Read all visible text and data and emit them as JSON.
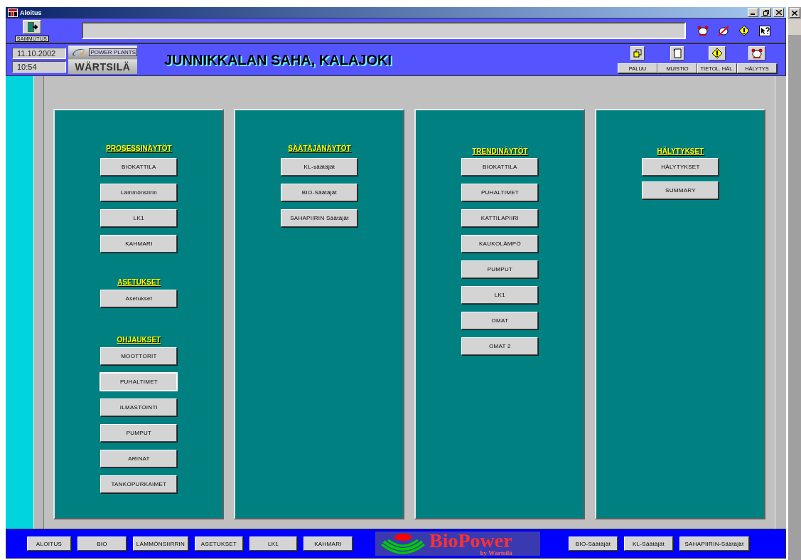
{
  "window": {
    "title": "Aloitus"
  },
  "toolbar": {
    "shutdown_label": "SAMMUTUS"
  },
  "header": {
    "date": "11.10.2002",
    "time": "10:54",
    "logo": {
      "tagline": "POWER PLANTS",
      "brand": "WÄRTSILÄ"
    },
    "title": "JUNNIKKALAN SAHA, KALAJOKI",
    "nav_buttons": [
      "PALUU",
      "MUISTIO",
      "TIETOL. HÄL.",
      "HÄLYTYS"
    ]
  },
  "panels": [
    {
      "sections": [
        {
          "heading": "PROSESSINÄYTÖT",
          "buttons": [
            {
              "label": "BIOKATTILA"
            },
            {
              "label": "Lämmönsiirin"
            },
            {
              "label": "LK1"
            },
            {
              "label": "KAHMARI"
            }
          ]
        },
        {
          "heading": "ASETUKSET",
          "buttons": [
            {
              "label": "Asetukset"
            }
          ]
        },
        {
          "heading": "OHJAUKSET",
          "buttons": [
            {
              "label": "MOOTTORIT",
              "focused": false
            },
            {
              "label": "PUHALTIMET",
              "focused": true
            },
            {
              "label": "ILMASTOINTI",
              "focused": false
            },
            {
              "label": "PUMPUT",
              "focused": false
            },
            {
              "label": "ARINAT",
              "focused": false
            },
            {
              "label": "TANKOPURKAIMET",
              "focused": false
            }
          ]
        }
      ]
    },
    {
      "sections": [
        {
          "heading": "SÄÄTÄJÄNÄYTÖT",
          "buttons": [
            {
              "label": "KL-säätäjät"
            },
            {
              "label": "BIO-Säätäjät"
            },
            {
              "label": "SAHAPIIRIN Säätäjät"
            }
          ]
        }
      ]
    },
    {
      "sections": [
        {
          "heading": "TRENDINÄYTÖT",
          "buttons": [
            {
              "label": "BIOKATTILA"
            },
            {
              "label": "PUHALTIMET"
            },
            {
              "label": "KATTILAPIIRI"
            },
            {
              "label": "KAUKOLÄMPÖ"
            },
            {
              "label": "PUMPUT"
            },
            {
              "label": "LK1"
            },
            {
              "label": "OMAT"
            },
            {
              "label": "OMAT 2"
            }
          ]
        }
      ]
    },
    {
      "sections": [
        {
          "heading": "HÄLYTYKSET",
          "buttons": [
            {
              "label": "HÄLYTYKSET"
            },
            {
              "label": "SUMMARY"
            }
          ]
        }
      ]
    }
  ],
  "bottom_bar": {
    "left_buttons": [
      "ALOITUS",
      "BIO",
      "LÄMMÖNSIIRRIN",
      "ASETUKSET",
      "LK1",
      "KAHMARI"
    ],
    "logo": {
      "name": "BioPower",
      "byline": "by Wärtsilä"
    },
    "right_buttons": [
      "BIO-Säätäjät",
      "KL-Säätäjät",
      "SAHAPIIRIN-Säätäjät"
    ]
  }
}
